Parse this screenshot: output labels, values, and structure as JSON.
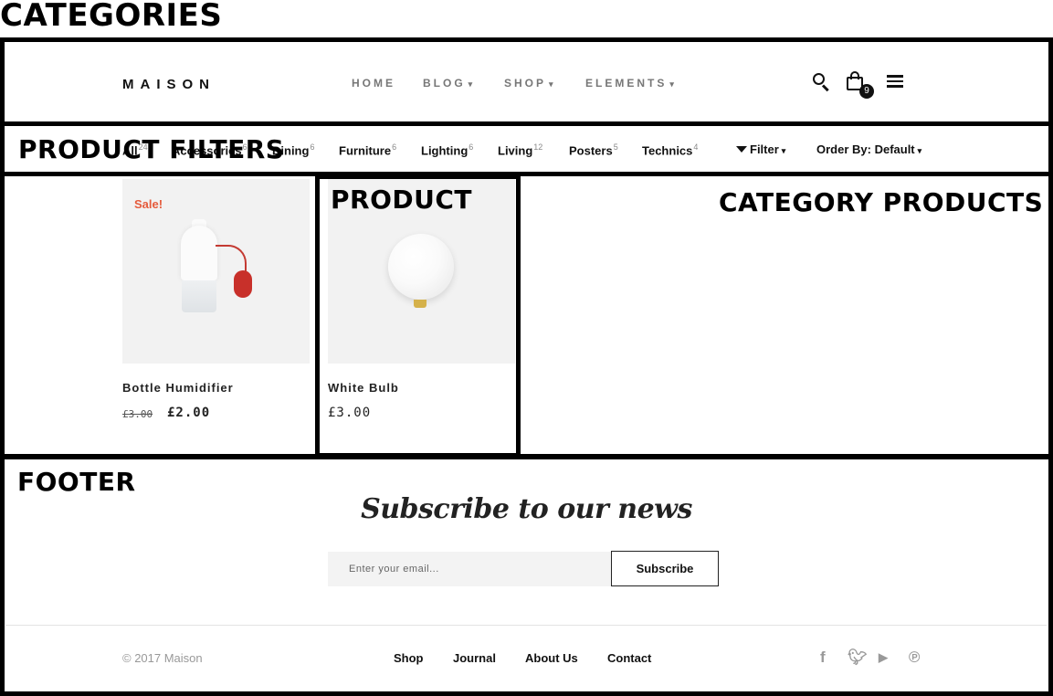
{
  "annotations": {
    "categories": "CATEGORIES",
    "product_filters": "PRODUCT FILTERS",
    "product": "PRODUCT",
    "category_products": "CATEGORY PRODUCTS",
    "footer": "FOOTER"
  },
  "header": {
    "logo": "MAISON",
    "nav": [
      {
        "label": "HOME"
      },
      {
        "label": "BLOG",
        "caret": "▾"
      },
      {
        "label": "SHOP",
        "caret": "▾"
      },
      {
        "label": "ELEMENTS",
        "caret": "▾"
      }
    ],
    "cart_count": "9",
    "icons": [
      "search-icon",
      "cart-icon",
      "menu-icon"
    ]
  },
  "filters": {
    "categories": [
      {
        "label": "All",
        "count": "24"
      },
      {
        "label": "Accessories",
        "count": "6"
      },
      {
        "label": "Dining",
        "count": "6"
      },
      {
        "label": "Furniture",
        "count": "6"
      },
      {
        "label": "Lighting",
        "count": "6"
      },
      {
        "label": "Living",
        "count": "12"
      },
      {
        "label": "Posters",
        "count": "5"
      },
      {
        "label": "Technics",
        "count": "4"
      }
    ],
    "filter_label": "Filter",
    "order_label": "Order By: Default"
  },
  "products": [
    {
      "name": "Bottle Humidifier",
      "badge": "Sale!",
      "old_price": "£3.00",
      "price": "£2.00"
    },
    {
      "name": "White Bulb",
      "price": "£3.00"
    }
  ],
  "footer": {
    "subscribe_title": "Subscribe to our news",
    "email_placeholder": "Enter your email...",
    "subscribe_button": "Subscribe",
    "copyright": "© 2017 Maison",
    "links": [
      "Shop",
      "Journal",
      "About Us",
      "Contact"
    ],
    "social_icons": [
      "facebook-icon",
      "twitter-icon",
      "youtube-icon",
      "pinterest-icon"
    ]
  },
  "colors": {
    "accent": "#e55b3c",
    "text": "#111111",
    "muted": "#999999"
  }
}
